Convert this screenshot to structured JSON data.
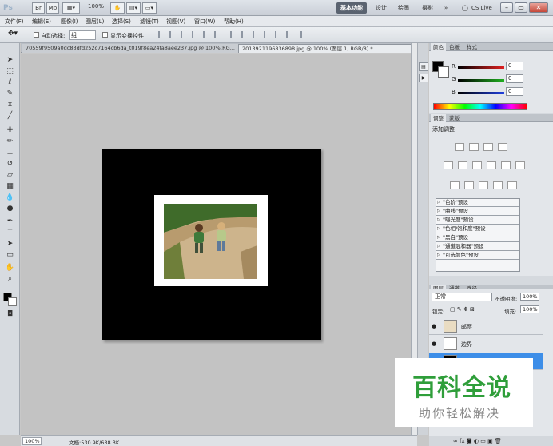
{
  "titlebar": {
    "logo": "Ps",
    "br_label": "Br",
    "mb_label": "Mb",
    "zoom": "100%",
    "workspaces": [
      "基本功能",
      "设计",
      "绘画",
      "摄影"
    ],
    "more": "»",
    "cs_live": "CS Live"
  },
  "menu": [
    "文件(F)",
    "编辑(E)",
    "图像(I)",
    "图层(L)",
    "选择(S)",
    "滤镜(T)",
    "视图(V)",
    "窗口(W)",
    "帮助(H)"
  ],
  "options": {
    "auto_select_label": "自动选择:",
    "auto_select_value": "组",
    "show_transform_label": "显示变换控件"
  },
  "documents": {
    "tab_inactive": "70559f9509a0dc83dfd252c7164cb6da_t019f8ea24fa8aee237.jpg @ 100%(RG...",
    "tab_active": "2013921196836898.jpg @ 100% (图层 1, RGB/8) *"
  },
  "status": {
    "zoom": "100%",
    "doc_info": "文档:530.9K/638.3K"
  },
  "color_panel": {
    "tabs": [
      "颜色",
      "色板",
      "样式"
    ],
    "channels": [
      {
        "label": "R",
        "value": "0",
        "color": "#e02020"
      },
      {
        "label": "G",
        "value": "0",
        "color": "#20b020"
      },
      {
        "label": "B",
        "value": "0",
        "color": "#2040e0"
      }
    ]
  },
  "adjust_panel": {
    "tabs": [
      "调整",
      "蒙版"
    ],
    "title": "添加调整",
    "presets": [
      "\"色阶\"预设",
      "\"曲线\"预设",
      "\"曝光度\"预设",
      "\"色相/饱和度\"预设",
      "\"黑白\"预设",
      "\"通道混和器\"预设",
      "\"可选颜色\"预设"
    ]
  },
  "layers_panel": {
    "tabs": [
      "图层",
      "通道",
      "路径"
    ],
    "blend_mode": "正常",
    "opacity_label": "不透明度:",
    "opacity": "100%",
    "lock_label": "锁定:",
    "fill_label": "填充:",
    "fill": "100%",
    "layers": [
      {
        "name": "邮票",
        "selected": false
      },
      {
        "name": "边界",
        "selected": false
      },
      {
        "name": "",
        "selected": true
      }
    ]
  },
  "watermark": {
    "big": "百科全说",
    "small": "助你轻松解决"
  }
}
